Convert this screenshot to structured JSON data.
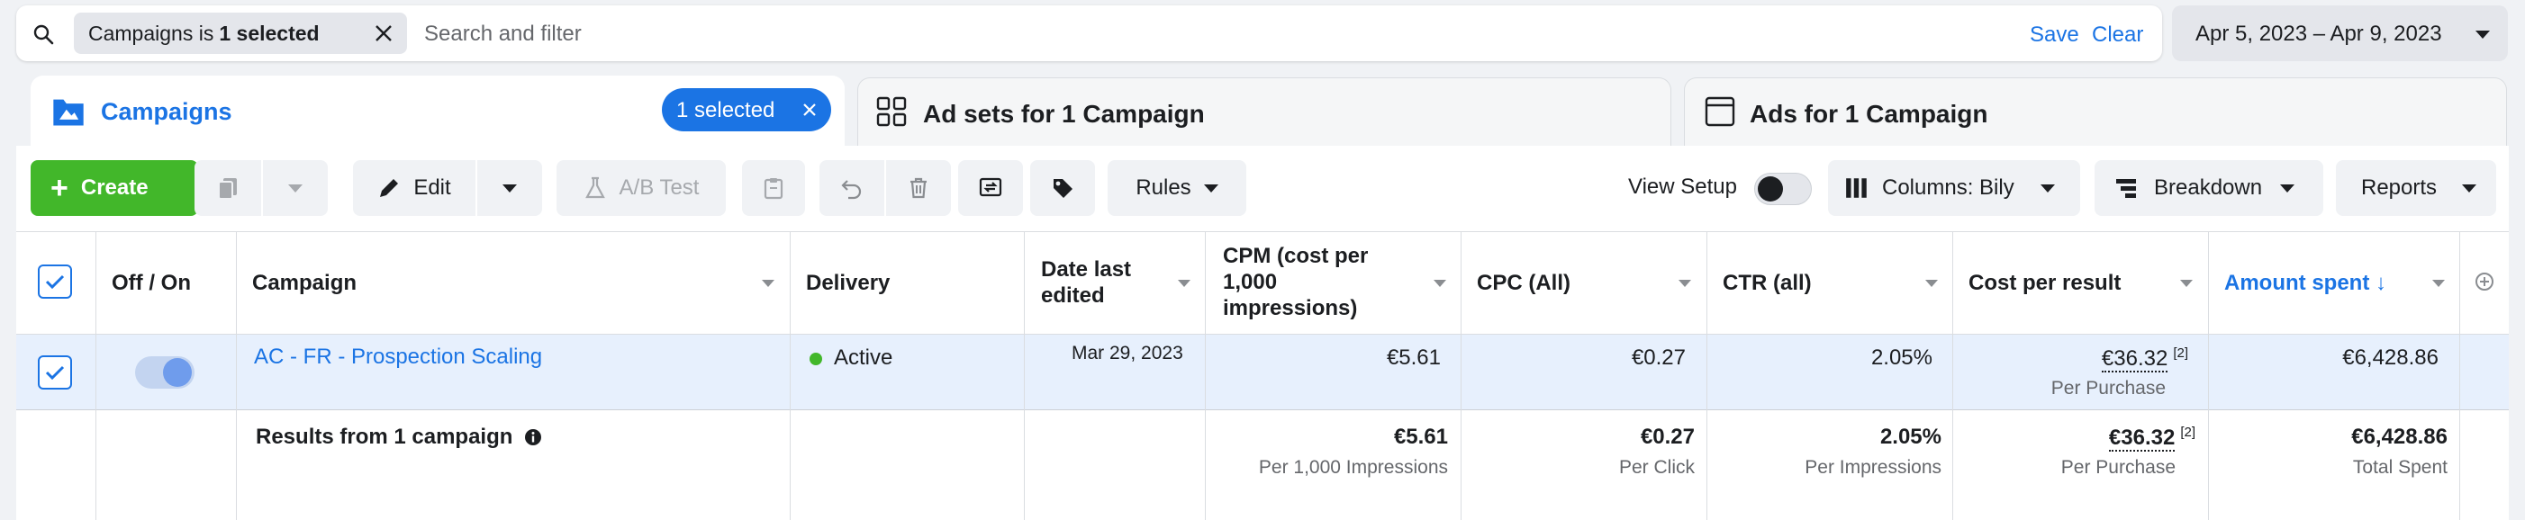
{
  "search": {
    "filter_prefix": "Campaigns is ",
    "filter_value": "1 selected",
    "placeholder": "Search and filter",
    "save_label": "Save",
    "clear_label": "Clear"
  },
  "date_range": "Apr 5, 2023 – Apr 9, 2023",
  "tabs": {
    "campaigns": {
      "label": "Campaigns",
      "selected_pill": "1 selected"
    },
    "adsets": {
      "label": "Ad sets for 1 Campaign"
    },
    "ads": {
      "label": "Ads for 1 Campaign"
    }
  },
  "toolbar": {
    "create_label": "Create",
    "edit_label": "Edit",
    "ab_test_label": "A/B Test",
    "rules_label": "Rules",
    "view_setup_label": "View Setup",
    "columns_label": "Columns: Bily",
    "breakdown_label": "Breakdown",
    "reports_label": "Reports"
  },
  "table": {
    "headers": {
      "off_on": "Off / On",
      "campaign": "Campaign",
      "delivery": "Delivery",
      "date_line1": "Date last",
      "date_line2": "edited",
      "cpm_line1": "CPM (cost per",
      "cpm_line2": "1,000",
      "cpm_line3": "impressions)",
      "cpc": "CPC (All)",
      "ctr": "CTR (all)",
      "cost_per_result": "Cost per result",
      "amount_spent": "Amount spent ↓"
    },
    "row": {
      "campaign": "AC - FR - Prospection Scaling",
      "delivery": "Active",
      "date": "Mar 29, 2023",
      "cpm": "€5.61",
      "cpc": "€0.27",
      "ctr": "2.05%",
      "cost_per_result": "€36.32",
      "cost_sup": "[2]",
      "cost_sub": "Per Purchase",
      "amount": "€6,428.86"
    },
    "summary": {
      "label": "Results from 1 campaign",
      "cpm": "€5.61",
      "cpm_sub": "Per 1,000 Impressions",
      "cpc": "€0.27",
      "cpc_sub": "Per Click",
      "ctr": "2.05%",
      "ctr_sub": "Per Impressions",
      "cost": "€36.32",
      "cost_sup": "[2]",
      "cost_sub": "Per Purchase",
      "amount": "€6,428.86",
      "amount_sub": "Total Spent"
    }
  },
  "colors": {
    "accent": "#1b74e4",
    "create_green": "#42b72a",
    "active_green": "#42b72a",
    "row_selected": "#e7f0fd"
  }
}
